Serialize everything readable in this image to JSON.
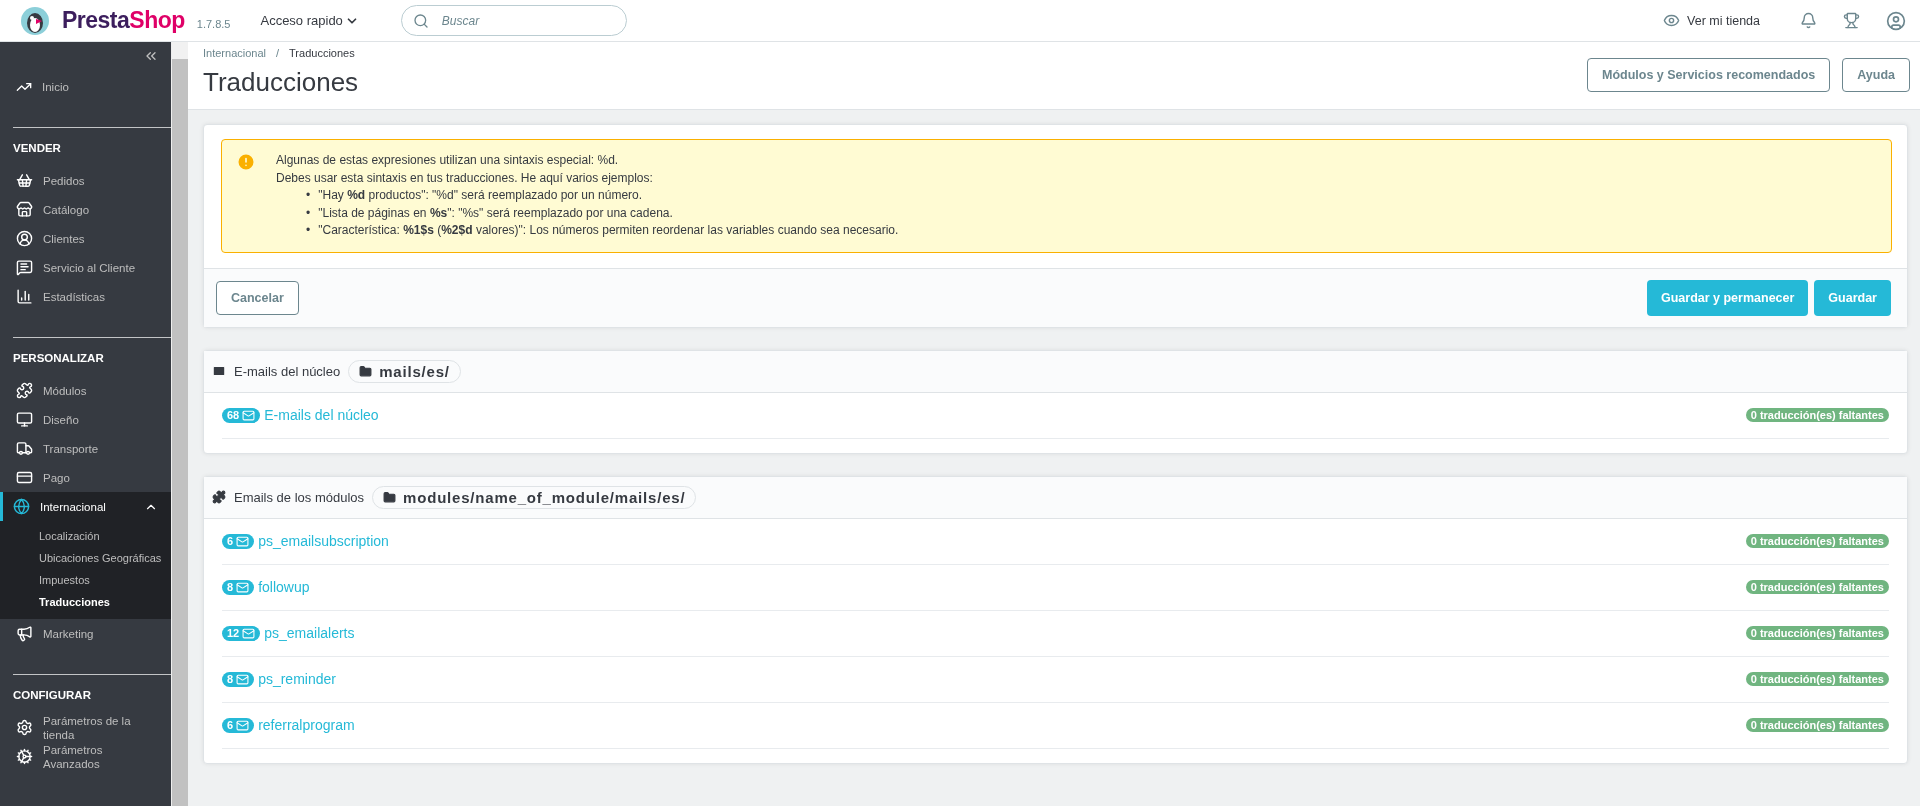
{
  "topbar": {
    "brand": {
      "first": "Presta",
      "second": "Shop"
    },
    "version": "1.7.8.5",
    "quick_access": "Acceso rapido",
    "search": {
      "placeholder": "Buscar"
    },
    "store_link": "Ver mi tienda"
  },
  "sidebar": {
    "top": [
      {
        "label": "Inicio",
        "selected": false
      }
    ],
    "sections": [
      {
        "title": "VENDER",
        "items": [
          {
            "label": "Pedidos",
            "selected": false
          },
          {
            "label": "Catálogo",
            "selected": false
          },
          {
            "label": "Clientes",
            "selected": false
          },
          {
            "label": "Servicio al Cliente",
            "selected": false
          },
          {
            "label": "Estadísticas",
            "selected": false
          }
        ]
      },
      {
        "title": "PERSONALIZAR",
        "items": [
          {
            "label": "Módulos",
            "selected": false
          },
          {
            "label": "Diseño",
            "selected": false
          },
          {
            "label": "Transporte",
            "selected": false
          },
          {
            "label": "Pago",
            "selected": false
          },
          {
            "label": "Internacional",
            "selected": true,
            "expanded": true,
            "children": [
              {
                "label": "Localización",
                "selected": false
              },
              {
                "label": "Ubicaciones Geográficas",
                "selected": false
              },
              {
                "label": "Impuestos",
                "selected": false
              },
              {
                "label": "Traducciones",
                "selected": true
              }
            ]
          },
          {
            "label": "Marketing",
            "selected": false
          }
        ]
      },
      {
        "title": "CONFIGURAR",
        "items": [
          {
            "label": "Parámetros de la tienda",
            "selected": false
          },
          {
            "label": "Parámetros Avanzados",
            "selected": false
          }
        ]
      }
    ]
  },
  "breadcrumb": [
    "Internacional",
    "Traducciones"
  ],
  "breadcrumb_separator": "/",
  "page_title": "Traducciones",
  "header_buttons": [
    "Módulos y Servicios recomendados",
    "Ayuda"
  ],
  "warning": {
    "intro": [
      "Algunas de estas expresiones utilizan una sintaxis especial: %d.",
      "Debes usar esta sintaxis en tus traducciones. He aquí varios ejemplos:"
    ],
    "marker": "•",
    "examples": [
      "\"Hay **%d** productos\": \"%d\" será reemplazado por un número.",
      "\"Lista de páginas en **%s**\": \"%s\" será reemplazado por una cadena.",
      "\"Característica: **%1$s** (**%2$d** valores)\": Los números permiten reordenar las variables cuando sea necesario."
    ]
  },
  "actions": {
    "cancel": "Cancelar",
    "save_stay": "Guardar y permanecer",
    "save": "Guardar"
  },
  "panels": [
    {
      "kind": "core",
      "title": "E-mails del núcleo",
      "path": "mails/es/",
      "rows": [
        {
          "count": "68",
          "name": "E-mails del núcleo",
          "missing": "0 traducción(es) faltantes"
        }
      ]
    },
    {
      "kind": "modules",
      "title": "Emails de los módulos",
      "path": "modules/name_of_module/mails/es/",
      "rows": [
        {
          "count": "6",
          "name": "ps_emailsubscription",
          "missing": "0 traducción(es) faltantes"
        },
        {
          "count": "8",
          "name": "followup",
          "missing": "0 traducción(es) faltantes"
        },
        {
          "count": "12",
          "name": "ps_emailalerts",
          "missing": "0 traducción(es) faltantes"
        },
        {
          "count": "8",
          "name": "ps_reminder",
          "missing": "0 traducción(es) faltantes"
        },
        {
          "count": "6",
          "name": "referralprogram",
          "missing": "0 traducción(es) faltantes"
        }
      ]
    }
  ]
}
